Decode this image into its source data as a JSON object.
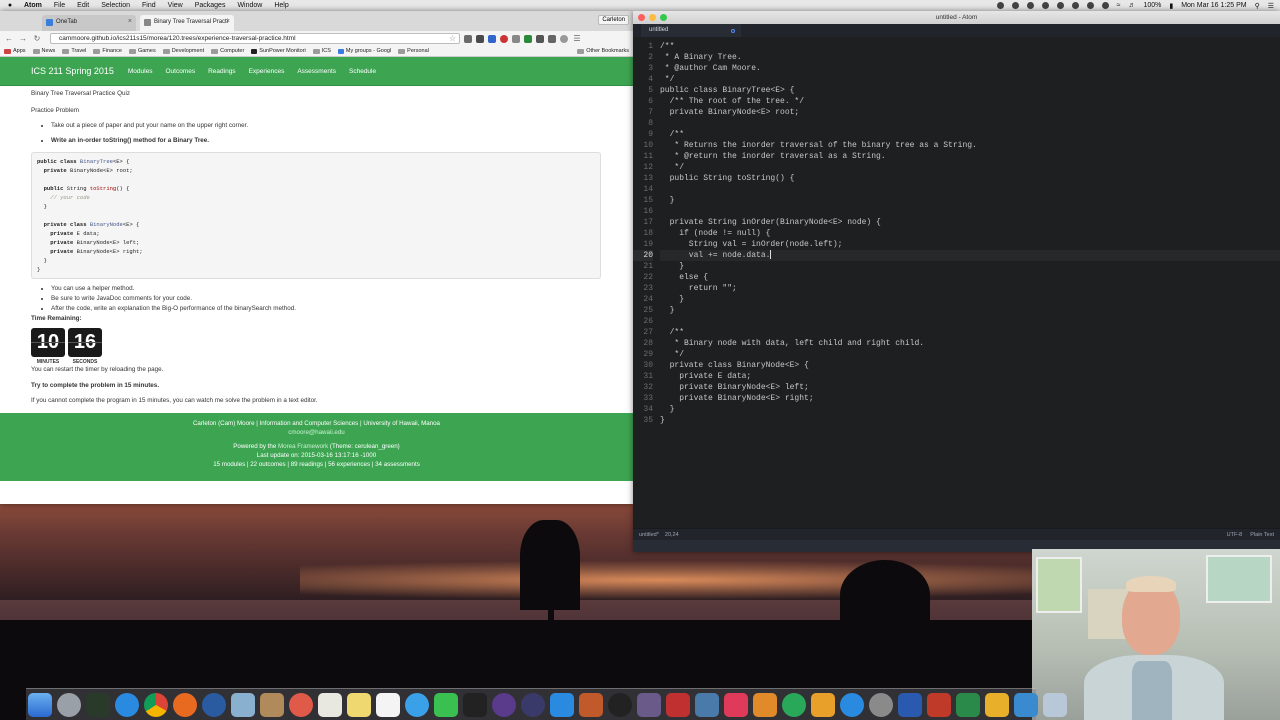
{
  "menubar": {
    "app": "Atom",
    "items": [
      "File",
      "Edit",
      "Selection",
      "Find",
      "View",
      "Packages",
      "Window",
      "Help"
    ],
    "battery": "100%",
    "datetime": "Mon Mar 16  1:25 PM"
  },
  "browser": {
    "tabs": [
      {
        "title": "OneTab",
        "active": false
      },
      {
        "title": "Binary Tree Traversal Practi",
        "active": true
      }
    ],
    "profile": "Carleton",
    "url": "cammoore.github.io/ics211s15/morea/120.trees/experience-traversal-practice.html",
    "bookmarks": [
      {
        "label": "Apps",
        "type": "apps"
      },
      {
        "label": "News",
        "type": "folder"
      },
      {
        "label": "Travel",
        "type": "folder"
      },
      {
        "label": "Finance",
        "type": "folder"
      },
      {
        "label": "Games",
        "type": "folder"
      },
      {
        "label": "Development",
        "type": "folder"
      },
      {
        "label": "Computer",
        "type": "folder"
      },
      {
        "label": "SunPower Monitori",
        "type": "site"
      },
      {
        "label": "ICS",
        "type": "folder"
      },
      {
        "label": "My groups - Googl",
        "type": "site"
      },
      {
        "label": "Personal",
        "type": "folder"
      }
    ],
    "other_bookmarks": "Other Bookmarks"
  },
  "page": {
    "brand": "ICS 211 Spring 2015",
    "nav": [
      "Modules",
      "Outcomes",
      "Readings",
      "Experiences",
      "Assessments",
      "Schedule"
    ],
    "title": "Binary Tree Traversal Practice Quiz",
    "subtitle": "Practice Problem",
    "bullets1": [
      {
        "text": "Take out a piece of paper and put your name on the upper right corner.",
        "bold": false
      },
      {
        "text": "Write an in-order toString() method for a Binary Tree.",
        "bold": true
      }
    ],
    "bullets2": [
      "You can use a helper method.",
      "Be sure to write JavaDoc comments for your code.",
      "After the code, write an explanation the Big-O performance of the binarySearch method."
    ],
    "time_remaining_label": "Time Remaining:",
    "timer": {
      "minutes": "10",
      "seconds": "16",
      "minutes_label": "MINUTES",
      "seconds_label": "SECONDS"
    },
    "restart_note": "You can restart the timer by reloading the page.",
    "try_note": "Try to complete the problem in 15 minutes.",
    "cannot_note": "If you cannot complete the program in 15 minutes, you can watch me solve the problem in a text editor.",
    "footer": {
      "line1": "Carleton (Cam) Moore | Information and Computer Sciences | University of Hawaii, Manoa",
      "email": "cmoore@hawaii.edu",
      "powered_prefix": "Powered by the ",
      "powered_link": "Morea Framework",
      "powered_suffix": " (Theme: cerulean_green)",
      "last_update": "Last update on: 2015-03-16 13:17:16 -1000",
      "stats": "15 modules | 22 outcomes | 89 readings | 56 experiences | 34 assessments"
    }
  },
  "atom": {
    "window_title": "untitled - Atom",
    "tab_title": "untitled",
    "current_line": 20,
    "status_left": "untitled*",
    "cursor_pos": "20,24",
    "encoding": "UTF-8",
    "grammar": "Plain Text",
    "lines": [
      "/**",
      " * A Binary Tree.",
      " * @author Cam Moore.",
      " */",
      "public class BinaryTree<E> {",
      "  /** The root of the tree. */",
      "  private BinaryNode<E> root;",
      "",
      "  /**",
      "   * Returns the inorder traversal of the binary tree as a String.",
      "   * @return the inorder traversal as a String.",
      "   */",
      "  public String toString() {",
      "",
      "  }",
      "",
      "  private String inOrder(BinaryNode<E> node) {",
      "    if (node != null) {",
      "      String val = inOrder(node.left);",
      "      val += node.data.",
      "    }",
      "    else {",
      "      return \"\";",
      "    }",
      "  }",
      "",
      "  /**",
      "   * Binary node with data, left child and right child.",
      "   */",
      "  private class BinaryNode<E> {",
      "    private E data;",
      "    private BinaryNode<E> left;",
      "    private BinaryNode<E> right;",
      "  }",
      "}"
    ]
  },
  "colors": {
    "accent_green": "#3da552",
    "editor_bg": "#1d1f21"
  }
}
